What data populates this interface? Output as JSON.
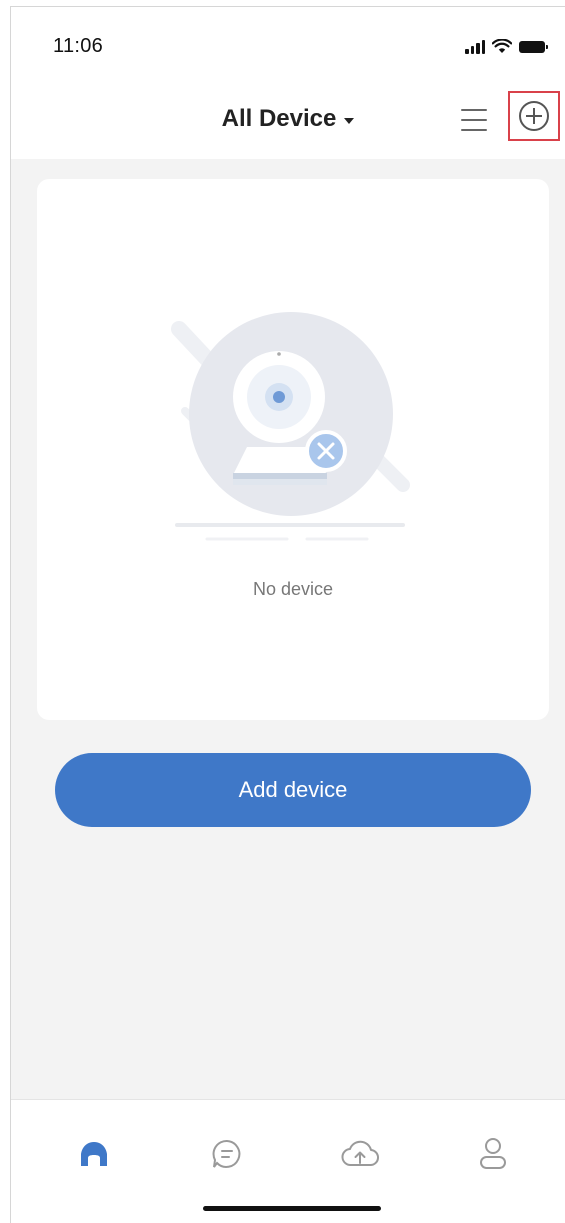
{
  "status_bar": {
    "time": "11:06",
    "icons": [
      "signal-icon",
      "wifi-icon",
      "battery-icon"
    ]
  },
  "nav": {
    "title": "All Device",
    "icons": [
      "caret-down-icon",
      "list-icon",
      "plus-circle-icon"
    ]
  },
  "empty_state": {
    "message": "No device",
    "illustration": "camera-icon"
  },
  "add_button": {
    "label": "Add device"
  },
  "tabs": [
    {
      "name": "home",
      "icon": "home-icon",
      "active": true
    },
    {
      "name": "messages",
      "icon": "message-icon",
      "active": false
    },
    {
      "name": "cloud",
      "icon": "cloud-upload-icon",
      "active": false
    },
    {
      "name": "profile",
      "icon": "user-icon",
      "active": false
    }
  ],
  "colors": {
    "accent": "#3f78c8",
    "highlight_border": "#d9414a",
    "background": "#f3f3f3",
    "icon_gray": "#9a9a9a"
  }
}
